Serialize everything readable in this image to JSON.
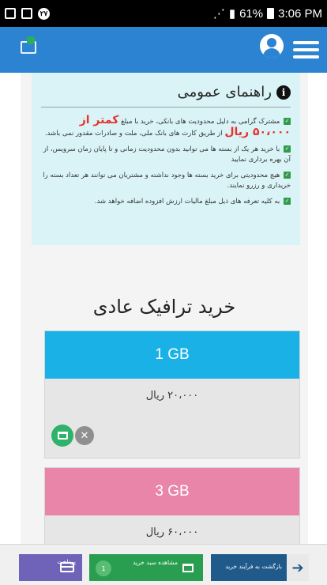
{
  "status_bar": {
    "badge_count": "۲۷",
    "battery": "61%",
    "time": "3:06 PM"
  },
  "guide": {
    "title": "راهنمای عمومی",
    "items": [
      "مشترک گرامی به دلیل محدودیت های بانکی، خرید با مبلغ",
      "کمتر از",
      "۵۰،۰۰۰ ریال",
      "از طریق کارت های بانک ملی، ملت و صادرات مقدور نمی باشد.",
      "با خرید هر یک از بسته ها می توانید بدون محدودیت زمانی و تا پایان زمان سرویس، از آن بهره برداری نمایید",
      "هیچ محدودیتی برای خرید بسته ها وجود نداشته و مشتریان می توانند هر تعداد بسته را خریداری و رزرو نمایند.",
      "به کلیه تعرفه های ذیل مبلغ مالیات ارزش افزوده اضافه خواهد شد."
    ]
  },
  "section_title": "خرید ترافیک عادی",
  "packages": [
    {
      "name": "1 GB",
      "price": "۲۰،۰۰۰ ریال",
      "color": "#1ab2e6"
    },
    {
      "name": "3 GB",
      "price": "۶۰،۰۰۰ ریال",
      "color": "#e885a9"
    }
  ],
  "bottom_bar": {
    "back_label": "بازگشت به فرآیند خرید",
    "cart_label": "مشاهده سبد خرید",
    "cart_count": "1",
    "pay_label": "پرداخت"
  }
}
